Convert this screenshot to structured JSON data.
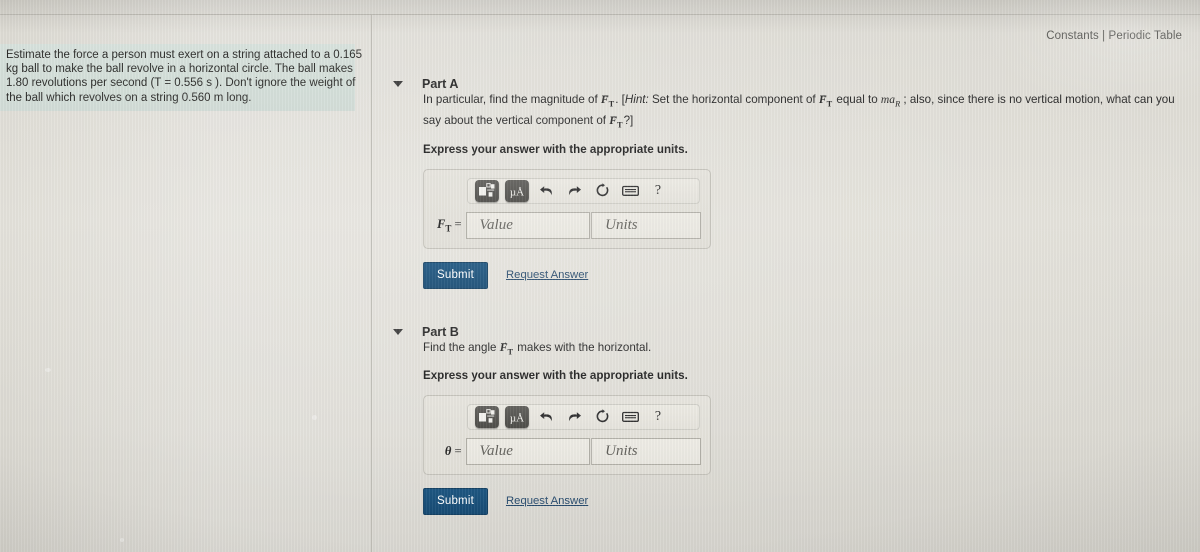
{
  "header": {
    "constants_link": "Constants | Periodic Table"
  },
  "question": {
    "lines": [
      "Estimate the force a person must exert on a string attached to a 0.165",
      "kg ball to make the ball revolve in a horizontal circle. The ball makes",
      "1.80 revolutions per second (T = 0.556 s ). Don't ignore the weight of",
      "the ball which revolves on a string 0.560 m long."
    ],
    "mass": "0.165",
    "mass_unit": "kg",
    "revolutions_per_second": "1.80",
    "period_symbol": "T",
    "period_value": "0.556",
    "period_unit": "s",
    "string_length": "0.560",
    "string_length_unit": "m"
  },
  "parts": [
    {
      "id": "A",
      "title": "Part A",
      "caret_icon": "caret-down-icon",
      "prompt_segments": {
        "s1": "In particular, find the magnitude of ",
        "sym1": "F",
        "sub1": "T",
        "s2": ". [",
        "hint_label": "Hint:",
        "s3": " Set the horizontal component of ",
        "sym2": "F",
        "sub2": "T",
        "s4": " equal to ",
        "ma": "ma",
        "ma_sub": "R",
        "s5": " ; also, since there is no vertical motion, what can you say about the vertical component of ",
        "sym3": "F",
        "sub3": "T",
        "s6": "?]"
      },
      "express": "Express your answer with the appropriate units.",
      "toolbar": {
        "template_icon": "math-template-icon",
        "units_icon": "micro-angstrom-units-icon",
        "undo_icon": "undo-arrow-icon",
        "redo_icon": "redo-arrow-icon",
        "reset_icon": "reset-circular-arrow-icon",
        "keyboard_icon": "keyboard-icon",
        "help_icon": "?"
      },
      "answer": {
        "label_symbol": "F",
        "label_sub": "T",
        "label_eq": "=",
        "value_placeholder": "Value",
        "units_placeholder": "Units",
        "value": "",
        "units": ""
      },
      "submit_label": "Submit",
      "request_answer_label": "Request Answer"
    },
    {
      "id": "B",
      "title": "Part B",
      "caret_icon": "caret-down-icon",
      "prompt_segments": {
        "s1": "Find the angle ",
        "sym1": "F",
        "sub1": "T",
        "s2": " makes with the horizontal."
      },
      "express": "Express your answer with the appropriate units.",
      "toolbar": {
        "template_icon": "math-template-icon",
        "units_icon": "micro-angstrom-units-icon",
        "undo_icon": "undo-arrow-icon",
        "redo_icon": "redo-arrow-icon",
        "reset_icon": "reset-circular-arrow-icon",
        "keyboard_icon": "keyboard-icon",
        "help_icon": "?"
      },
      "answer": {
        "label_symbol": "θ",
        "label_sub": "",
        "label_eq": "=",
        "value_placeholder": "Value",
        "units_placeholder": "Units",
        "value": "",
        "units": ""
      },
      "submit_label": "Submit",
      "request_answer_label": "Request Answer"
    }
  ],
  "colors": {
    "submit_blue": "#17507c",
    "link_blue": "#24486b",
    "question_panel_bg": "#d4dfd9",
    "page_bg": "#e1dfd8",
    "toolbar_btn_dark": "#4f4e4a"
  }
}
